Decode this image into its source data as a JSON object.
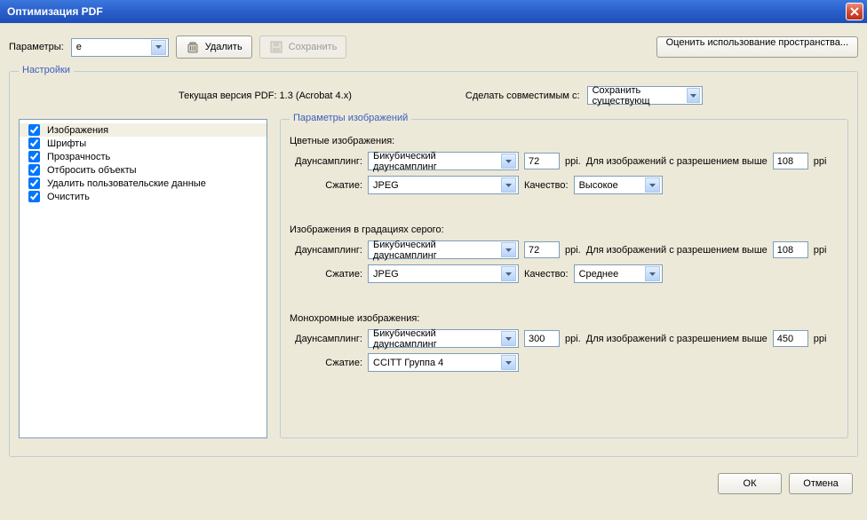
{
  "title": "Оптимизация PDF",
  "toolbar": {
    "params_label": "Параметры:",
    "params_value": "e",
    "delete_label": "Удалить",
    "save_label": "Сохранить",
    "space_label": "Оценить использование пространства..."
  },
  "settings": {
    "legend": "Настройки",
    "version_label": "Текущая версия PDF: 1.3 (Acrobat 4.x)",
    "compat_label": "Сделать совместимым с:",
    "compat_value": "Сохранить существующ",
    "categories": [
      {
        "label": "Изображения",
        "checked": true,
        "selected": true
      },
      {
        "label": "Шрифты",
        "checked": true
      },
      {
        "label": "Прозрачность",
        "checked": true
      },
      {
        "label": "Отбросить объекты",
        "checked": true
      },
      {
        "label": "Удалить пользовательские данные",
        "checked": true
      },
      {
        "label": "Очистить",
        "checked": true
      }
    ]
  },
  "imageparams": {
    "legend": "Параметры изображений",
    "labels": {
      "downsampling": "Даунсамплинг:",
      "compression": "Сжатие:",
      "quality": "Качество:",
      "ppi": "ppi.",
      "ppi_plain": "ppi",
      "for_above": "Для изображений с разрешением выше"
    },
    "color": {
      "title": "Цветные изображения:",
      "downsampling": "Бикубический даунсамплинг",
      "target_ppi": "72",
      "above_ppi": "108",
      "compression": "JPEG",
      "quality": "Высокое"
    },
    "gray": {
      "title": "Изображения в градациях серого:",
      "downsampling": "Бикубический даунсамплинг",
      "target_ppi": "72",
      "above_ppi": "108",
      "compression": "JPEG",
      "quality": "Среднее"
    },
    "mono": {
      "title": "Монохромные изображения:",
      "downsampling": "Бикубический даунсамплинг",
      "target_ppi": "300",
      "above_ppi": "450",
      "compression": "CCITT Группа 4"
    }
  },
  "buttons": {
    "ok": "ОК",
    "cancel": "Отмена"
  }
}
